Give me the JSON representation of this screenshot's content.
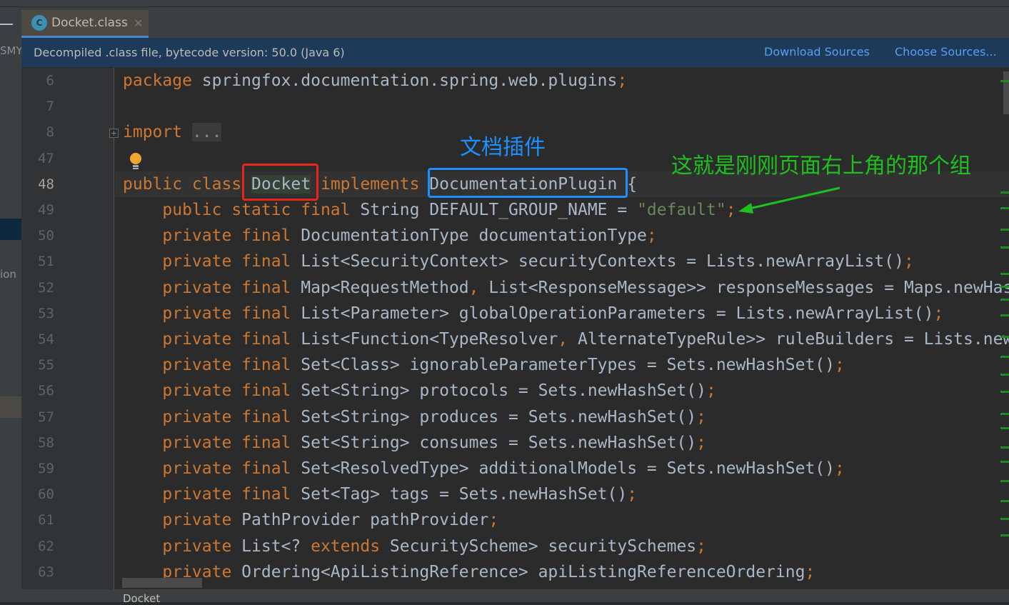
{
  "sidebar": {
    "labels": [
      "SMY",
      "ion"
    ]
  },
  "tab": {
    "label": "Docket.class",
    "icon": "class-icon"
  },
  "infobar": {
    "message": "Decompiled .class file, bytecode version: 50.0 (Java 6)",
    "download_sources": "Download Sources",
    "choose_sources": "Choose Sources..."
  },
  "editor": {
    "lines": [
      {
        "n": "6",
        "tokens": [
          [
            "kw",
            "package "
          ],
          [
            "id",
            "springfox.documentation.spring.web.plugins"
          ],
          [
            "kw",
            ";"
          ]
        ]
      },
      {
        "n": "7",
        "tokens": []
      },
      {
        "n": "8",
        "tokens": [
          [
            "kw",
            "import "
          ],
          [
            "fold",
            "..."
          ]
        ]
      },
      {
        "n": "47",
        "tokens": []
      },
      {
        "n": "48",
        "tokens": [
          [
            "kw",
            "public class "
          ],
          [
            "hl",
            "Docket"
          ],
          [
            "id",
            " "
          ],
          [
            "kw",
            "implements "
          ],
          [
            "id",
            "DocumentationPlugin {"
          ]
        ]
      },
      {
        "n": "49",
        "tokens": [
          [
            "kw",
            "    public static final "
          ],
          [
            "id",
            "String DEFAULT_GROUP_NAME = "
          ],
          [
            "str",
            "\"default\""
          ],
          [
            "kw",
            ";"
          ]
        ]
      },
      {
        "n": "50",
        "tokens": [
          [
            "kw",
            "    private final "
          ],
          [
            "id",
            "DocumentationType documentationType"
          ],
          [
            "kw",
            ";"
          ]
        ]
      },
      {
        "n": "51",
        "tokens": [
          [
            "kw",
            "    private final "
          ],
          [
            "id",
            "List<SecurityContext> securityContexts = Lists.newArrayList()"
          ],
          [
            "kw",
            ";"
          ]
        ]
      },
      {
        "n": "52",
        "tokens": [
          [
            "kw",
            "    private final "
          ],
          [
            "id",
            "Map<RequestMethod"
          ],
          [
            "kw",
            ", "
          ],
          [
            "id",
            "List<ResponseMessage>> responseMessages = Maps.newHashMap()"
          ],
          [
            "kw",
            ";"
          ]
        ]
      },
      {
        "n": "53",
        "tokens": [
          [
            "kw",
            "    private final "
          ],
          [
            "id",
            "List<Parameter> globalOperationParameters = Lists.newArrayList()"
          ],
          [
            "kw",
            ";"
          ]
        ]
      },
      {
        "n": "54",
        "tokens": [
          [
            "kw",
            "    private final "
          ],
          [
            "id",
            "List<Function<TypeResolver"
          ],
          [
            "kw",
            ", "
          ],
          [
            "id",
            "AlternateTypeRule>> ruleBuilders = Lists.newArrayList()"
          ],
          [
            "kw",
            ";"
          ]
        ]
      },
      {
        "n": "55",
        "tokens": [
          [
            "kw",
            "    private final "
          ],
          [
            "id",
            "Set<Class> ignorableParameterTypes = Sets.newHashSet()"
          ],
          [
            "kw",
            ";"
          ]
        ]
      },
      {
        "n": "56",
        "tokens": [
          [
            "kw",
            "    private final "
          ],
          [
            "id",
            "Set<String> protocols = Sets.newHashSet()"
          ],
          [
            "kw",
            ";"
          ]
        ]
      },
      {
        "n": "57",
        "tokens": [
          [
            "kw",
            "    private final "
          ],
          [
            "id",
            "Set<String> produces = Sets.newHashSet()"
          ],
          [
            "kw",
            ";"
          ]
        ]
      },
      {
        "n": "58",
        "tokens": [
          [
            "kw",
            "    private final "
          ],
          [
            "id",
            "Set<String> consumes = Sets.newHashSet()"
          ],
          [
            "kw",
            ";"
          ]
        ]
      },
      {
        "n": "59",
        "tokens": [
          [
            "kw",
            "    private final "
          ],
          [
            "id",
            "Set<ResolvedType> additionalModels = Sets.newHashSet()"
          ],
          [
            "kw",
            ";"
          ]
        ]
      },
      {
        "n": "60",
        "tokens": [
          [
            "kw",
            "    private final "
          ],
          [
            "id",
            "Set<Tag> tags = Sets.newHashSet()"
          ],
          [
            "kw",
            ";"
          ]
        ]
      },
      {
        "n": "61",
        "tokens": [
          [
            "kw",
            "    private "
          ],
          [
            "id",
            "PathProvider pathProvider"
          ],
          [
            "kw",
            ";"
          ]
        ]
      },
      {
        "n": "62",
        "tokens": [
          [
            "kw",
            "    private "
          ],
          [
            "id",
            "List<? "
          ],
          [
            "kw",
            "extends "
          ],
          [
            "id",
            "SecurityScheme> securitySchemes"
          ],
          [
            "kw",
            ";"
          ]
        ]
      },
      {
        "n": "63",
        "tokens": [
          [
            "kw",
            "    private "
          ],
          [
            "id",
            "Ordering<ApiListingReference> apiListingReferenceOrdering"
          ],
          [
            "kw",
            ";"
          ]
        ]
      }
    ]
  },
  "annotations": {
    "blue_label": "文档插件",
    "green_label": "这就是刚刚页面右上角的那个组",
    "red": "#e8261c",
    "blue": "#1e8fff",
    "green": "#1fbf1f"
  },
  "status": {
    "breadcrumb": "Docket"
  }
}
